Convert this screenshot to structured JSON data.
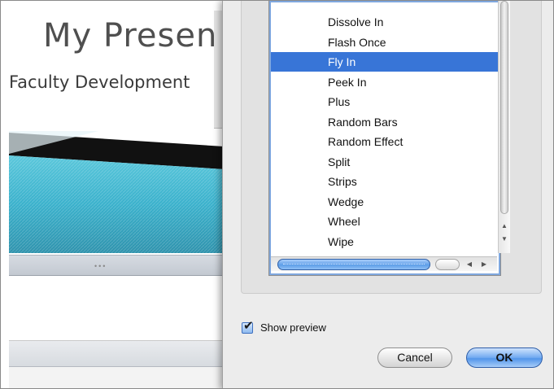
{
  "slide": {
    "title": "My Present",
    "subtitle": "Faculty Development",
    "pane_dots": "•••"
  },
  "dialog": {
    "effects": [
      {
        "label": "Dissolve In",
        "selected": false
      },
      {
        "label": "Flash Once",
        "selected": false
      },
      {
        "label": "Fly In",
        "selected": true
      },
      {
        "label": "Peek In",
        "selected": false
      },
      {
        "label": "Plus",
        "selected": false
      },
      {
        "label": "Random Bars",
        "selected": false
      },
      {
        "label": "Random Effect",
        "selected": false
      },
      {
        "label": "Split",
        "selected": false
      },
      {
        "label": "Strips",
        "selected": false
      },
      {
        "label": "Wedge",
        "selected": false
      },
      {
        "label": "Wheel",
        "selected": false
      },
      {
        "label": "Wipe",
        "selected": false
      }
    ],
    "show_preview": {
      "label": "Show preview",
      "checked": true
    },
    "cancel_label": "Cancel",
    "ok_label": "OK"
  },
  "colors": {
    "selection": "#3875d7",
    "accent": "#5295ea",
    "banner": "#3ab1cc"
  },
  "icons": {
    "check": "✔",
    "arrow_up": "▲",
    "arrow_down": "▼",
    "arrow_left": "◀",
    "arrow_right": "▶"
  }
}
